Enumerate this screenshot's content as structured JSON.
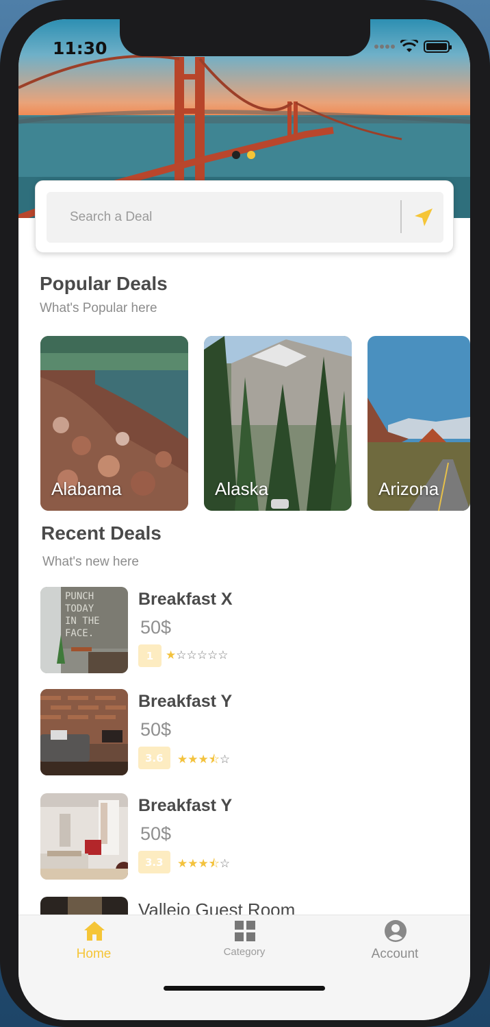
{
  "status_bar": {
    "time": "11:30"
  },
  "search": {
    "placeholder": "Search a Deal"
  },
  "popular": {
    "title": "Popular Deals",
    "subtitle": "What's Popular here",
    "items": [
      {
        "label": "Alabama"
      },
      {
        "label": "Alaska"
      },
      {
        "label": "Arizona"
      }
    ]
  },
  "recent": {
    "title": "Recent Deals",
    "subtitle": "What's new here",
    "items": [
      {
        "name": "Breakfast X",
        "price": "50$",
        "rating": "1",
        "stars": 1
      },
      {
        "name": "Breakfast Y",
        "price": "50$",
        "rating": "3.6",
        "stars": 3.5
      },
      {
        "name": "Breakfast Y",
        "price": "50$",
        "rating": "3.3",
        "stars": 3.5
      },
      {
        "name": "Vallejo Guest Room"
      }
    ]
  },
  "tabbar": {
    "items": [
      {
        "label": "Home",
        "icon": "home-icon",
        "active": true
      },
      {
        "label": "Category",
        "icon": "grid-icon",
        "active": false
      },
      {
        "label": "Account",
        "icon": "user-icon",
        "active": false
      }
    ]
  },
  "colors": {
    "accent": "#f5c537",
    "text_dark": "#4a4a4a",
    "text_muted": "#8c8c8c"
  }
}
